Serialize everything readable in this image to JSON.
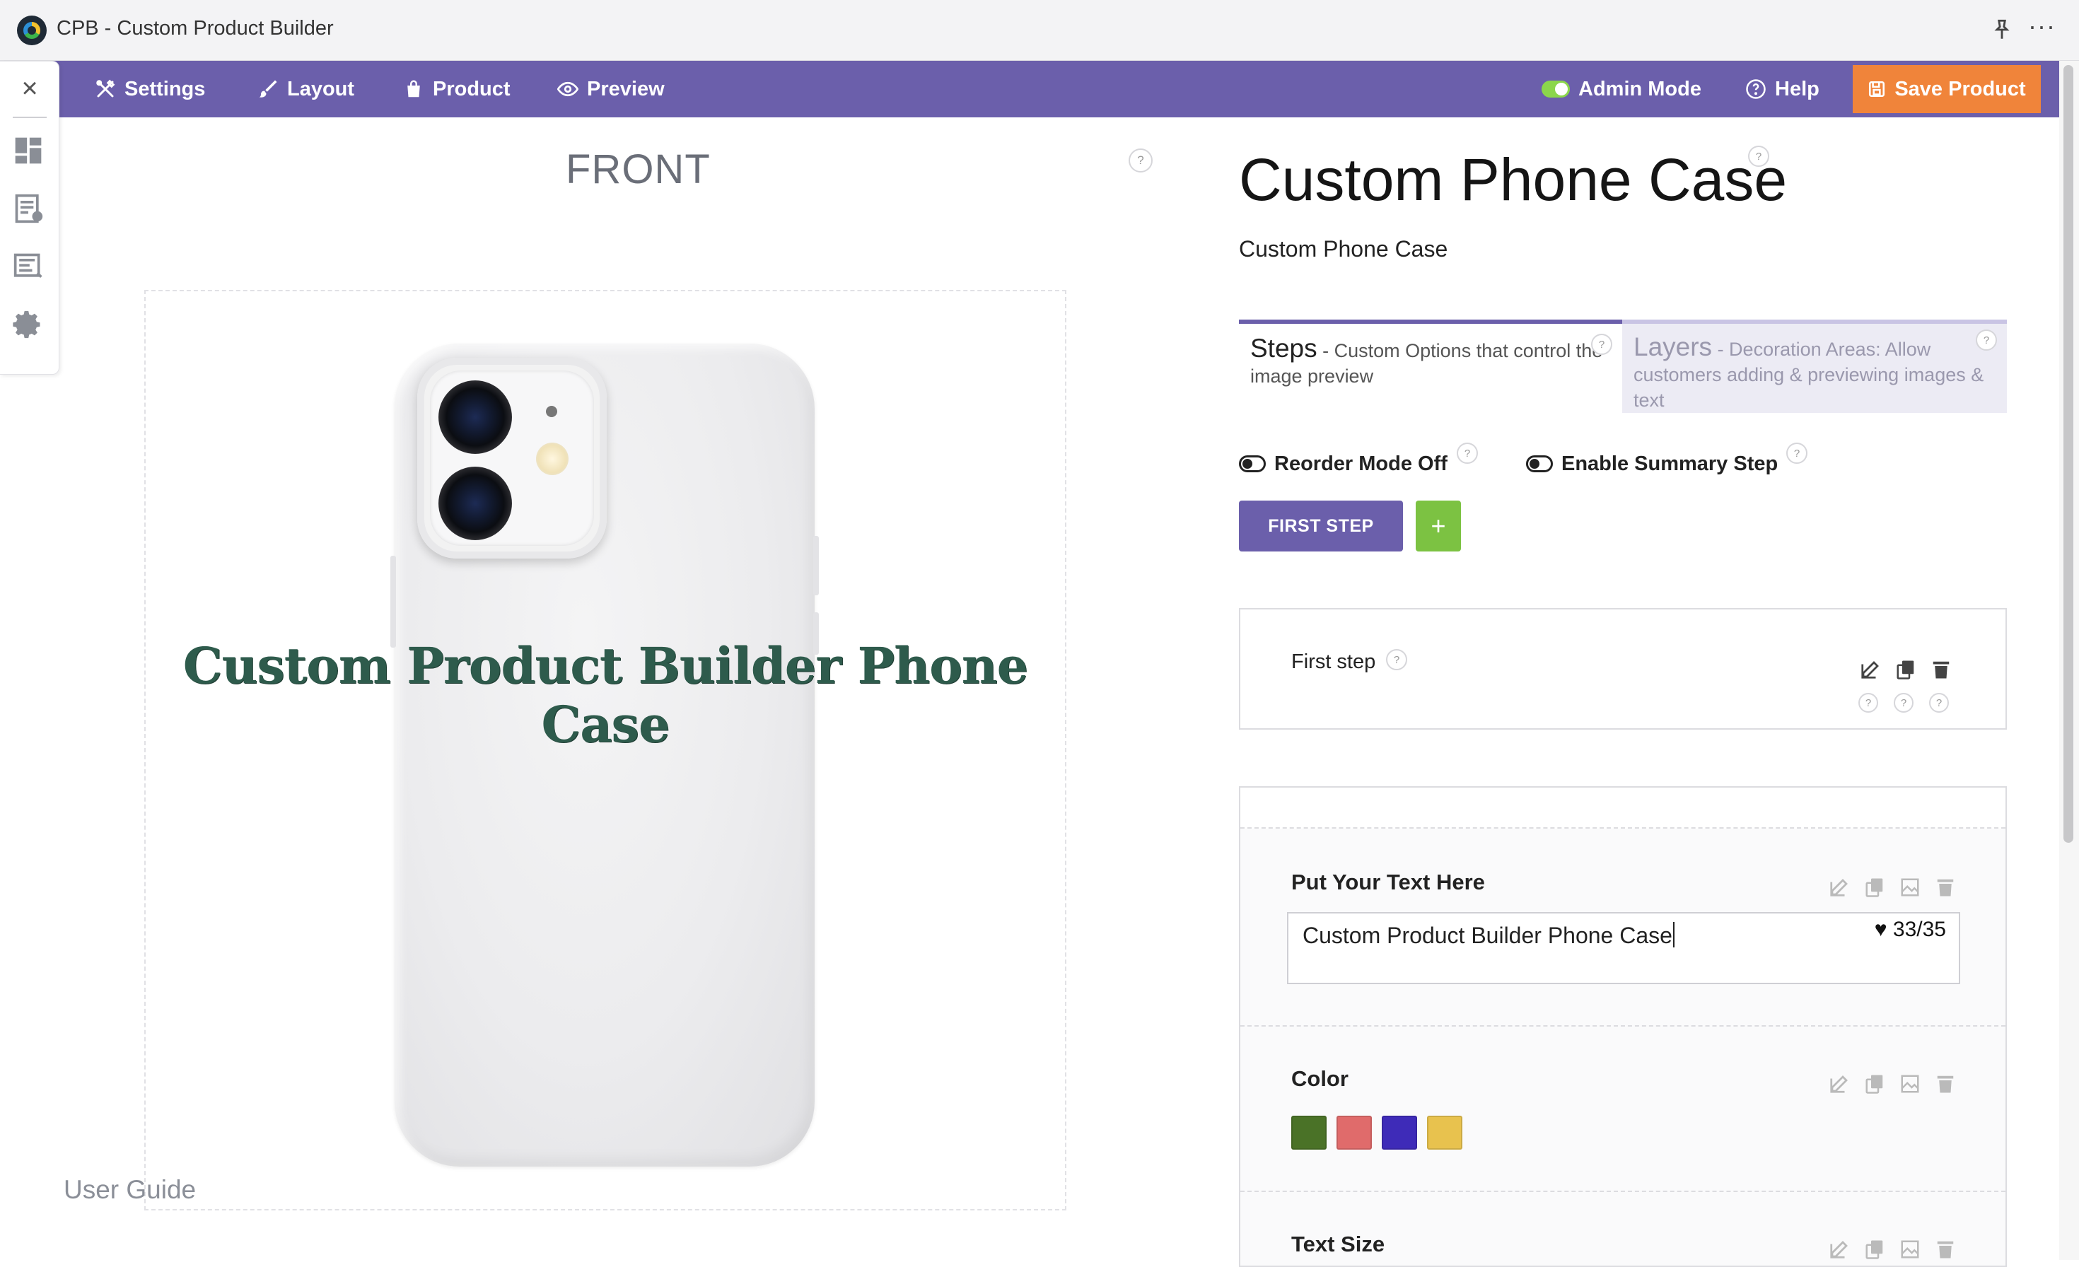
{
  "window": {
    "title": "CPB - Custom Product Builder"
  },
  "toolbar": {
    "settings": "Settings",
    "layout": "Layout",
    "product": "Product",
    "preview": "Preview",
    "admin_mode": "Admin Mode",
    "help": "Help",
    "save": "Save Product",
    "accent": "#6b5fab",
    "save_color": "#f0843a"
  },
  "canvas": {
    "side_label": "FRONT",
    "custom_text": "Custom Product Builder Phone Case",
    "user_guide": "User Guide"
  },
  "product": {
    "title": "Custom Phone Case",
    "subtitle": "Custom Phone Case"
  },
  "tabs": {
    "steps_head": "Steps",
    "steps_desc": " - Custom Options that control the image preview",
    "layers_head": "Layers",
    "layers_desc": " - Decoration Areas: Allow customers adding & previewing images & text"
  },
  "switches": {
    "reorder": "Reorder Mode Off",
    "summary": "Enable Summary Step"
  },
  "steps": {
    "first_step_button": "FIRST STEP",
    "add_button": "+",
    "card_label": "First step"
  },
  "options": {
    "text_label": "Put Your Text Here",
    "text_value": "Custom Product Builder Phone Case",
    "text_counter": "♥ 33/35",
    "color_label": "Color",
    "colors": [
      "#4a7227",
      "#e06b6b",
      "#3e2bb8",
      "#e8c24e"
    ],
    "size_label": "Text Size"
  },
  "help_mark": "?"
}
